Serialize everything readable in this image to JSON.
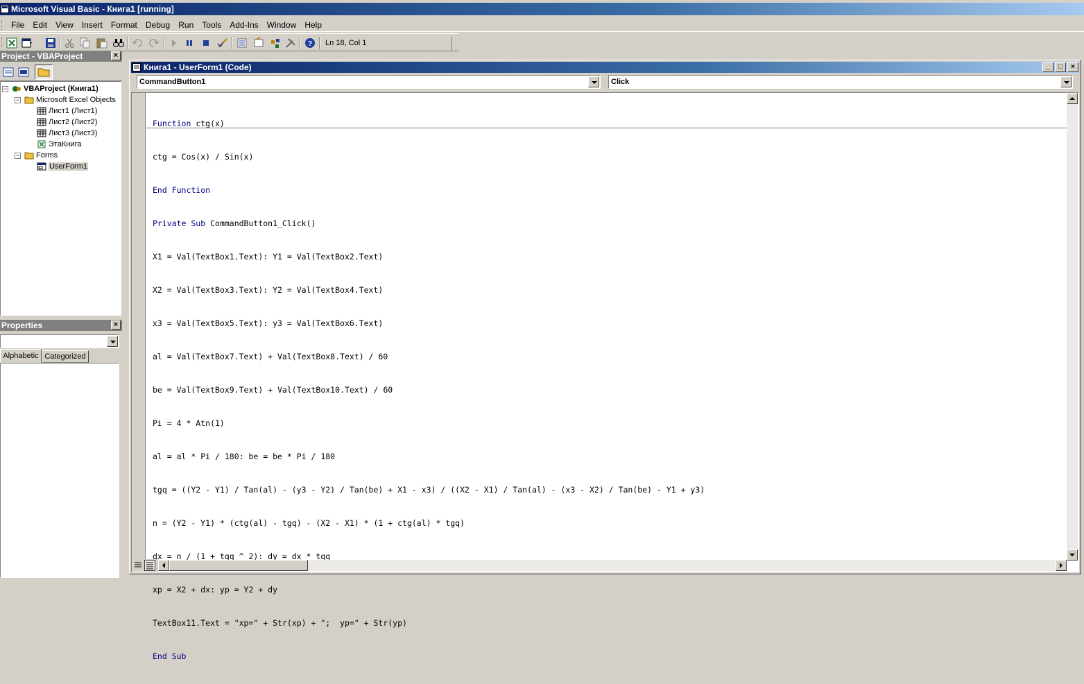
{
  "window": {
    "title": "Microsoft Visual Basic - Книга1 [running]"
  },
  "menu": [
    "File",
    "Edit",
    "View",
    "Insert",
    "Format",
    "Debug",
    "Run",
    "Tools",
    "Add-Ins",
    "Window",
    "Help"
  ],
  "toolbar": {
    "position_text": "Ln 18, Col 1"
  },
  "project": {
    "title": "Project - VBAProject",
    "tree": [
      {
        "label": "VBAProject (Книга1)",
        "icon": "vba-project-icon",
        "bold": true
      },
      {
        "label": "Microsoft Excel Objects",
        "icon": "folder-open-icon"
      },
      {
        "label": "Лист1 (Лист1)",
        "icon": "sheet-icon"
      },
      {
        "label": "Лист2 (Лист2)",
        "icon": "sheet-icon"
      },
      {
        "label": "Лист3 (Лист3)",
        "icon": "sheet-icon"
      },
      {
        "label": "ЭтаКнига",
        "icon": "workbook-icon"
      },
      {
        "label": "Forms",
        "icon": "folder-open-icon"
      },
      {
        "label": "UserForm1",
        "icon": "userform-icon",
        "selected": true
      }
    ]
  },
  "properties": {
    "title": "Properties",
    "tabs": [
      "Alphabetic",
      "Categorized"
    ],
    "active_tab": "Alphabetic"
  },
  "code_window": {
    "title": "Книга1 - UserForm1 (Code)",
    "object_combo": "CommandButton1",
    "procedure_combo": "Click",
    "lines": [
      "Function ctg(x)",
      "ctg = Cos(x) / Sin(x)",
      "End Function",
      "Private Sub CommandButton1_Click()",
      "X1 = Val(TextBox1.Text): Y1 = Val(TextBox2.Text)",
      "X2 = Val(TextBox3.Text): Y2 = Val(TextBox4.Text)",
      "x3 = Val(TextBox5.Text): y3 = Val(TextBox6.Text)",
      "al = Val(TextBox7.Text) + Val(TextBox8.Text) / 60",
      "be = Val(TextBox9.Text) + Val(TextBox10.Text) / 60",
      "Pi = 4 * Atn(1)",
      "al = al * Pi / 180: be = be * Pi / 180",
      "tgq = ((Y2 - Y1) / Tan(al) - (y3 - Y2) / Tan(be) + X1 - x3) / ((X2 - X1) / Tan(al) - (x3 - X2) / Tan(be) - Y1 + y3)",
      "n = (Y2 - Y1) * (ctg(al) - tgq) - (X2 - X1) * (1 + ctg(al) * tgq)",
      "dx = n / (1 + tgq ^ 2): dy = dx * tgq",
      "xp = X2 + dx: yp = Y2 + dy",
      "TextBox11.Text = \"xp=\" + Str(xp) + \";  yp=\" + Str(yp)",
      "End Sub"
    ]
  },
  "colors": {
    "titlebar_start": "#0a246a",
    "titlebar_end": "#a6caf0",
    "keyword": "#00007f",
    "face": "#d4d0c8"
  }
}
